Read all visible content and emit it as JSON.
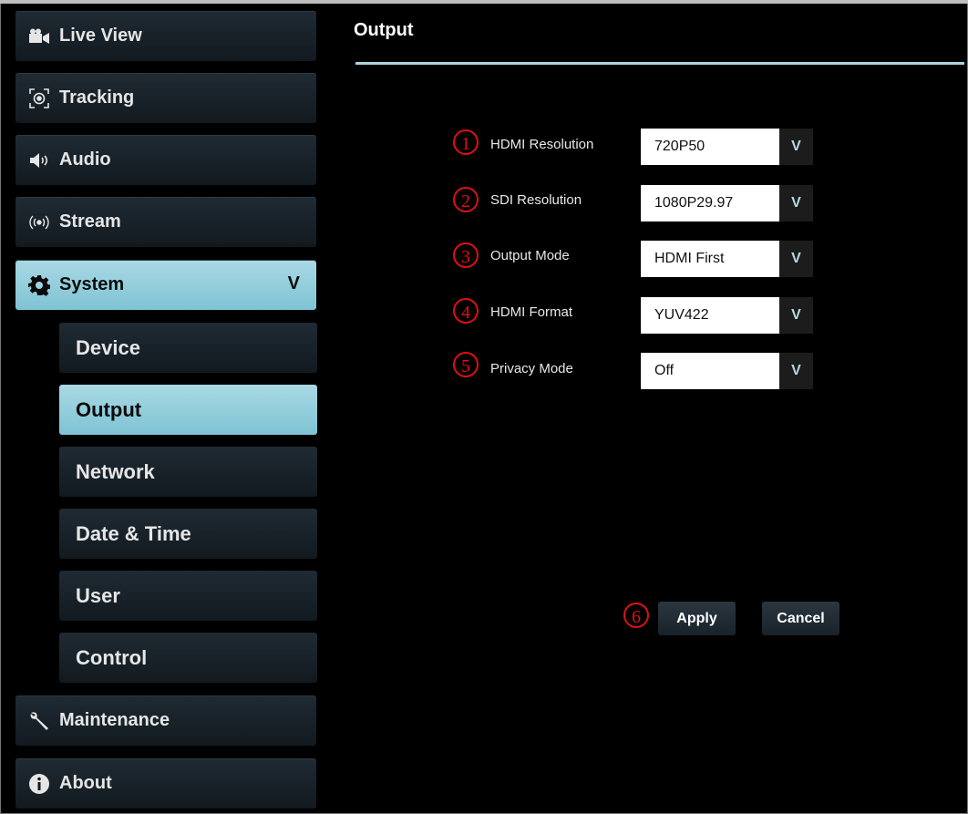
{
  "sidebar": {
    "items": [
      {
        "label": "Live View",
        "icon": "video-camera-icon"
      },
      {
        "label": "Tracking",
        "icon": "tracking-target-icon"
      },
      {
        "label": "Audio",
        "icon": "speaker-icon"
      },
      {
        "label": "Stream",
        "icon": "broadcast-icon"
      },
      {
        "label": "System",
        "icon": "gear-icon",
        "expanded_indicator": "V"
      },
      {
        "label": "Maintenance",
        "icon": "wrench-icon"
      },
      {
        "label": "About",
        "icon": "info-icon"
      }
    ],
    "system_sub": [
      "Device",
      "Output",
      "Network",
      "Date & Time",
      "User",
      "Control"
    ]
  },
  "main": {
    "title": "Output",
    "fields": [
      {
        "marker": "1",
        "label": "HDMI Resolution",
        "value": "720P50"
      },
      {
        "marker": "2",
        "label": "SDI Resolution",
        "value": "1080P29.97"
      },
      {
        "marker": "3",
        "label": "Output Mode",
        "value": "HDMI First"
      },
      {
        "marker": "4",
        "label": "HDMI Format",
        "value": "YUV422"
      },
      {
        "marker": "5",
        "label": "Privacy Mode",
        "value": "Off"
      }
    ],
    "dropdown_glyph": "V",
    "actions_marker": "6",
    "apply_label": "Apply",
    "cancel_label": "Cancel"
  },
  "colors": {
    "accent": "#8ccbd9",
    "marker": "#e01010",
    "background": "#000000"
  }
}
